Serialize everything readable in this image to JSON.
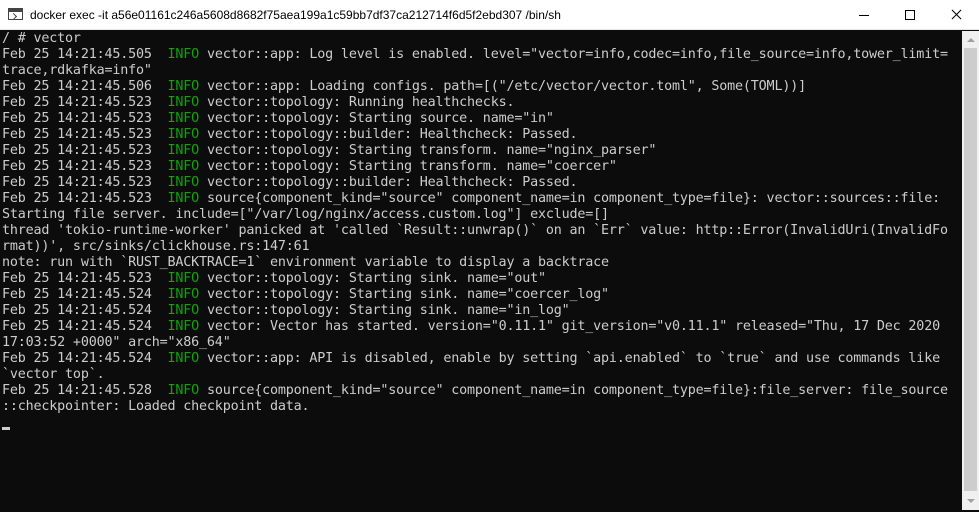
{
  "window": {
    "title": "docker  exec -it a56e01161c246a5608d8682f75aea199a1c59bb7df37ca212714f6d5f2ebd307 /bin/sh",
    "icon": "console-app-icon"
  },
  "controls": {
    "minimize_icon": "minimize-icon",
    "maximize_icon": "maximize-icon",
    "close_icon": "close-icon"
  },
  "colors": {
    "background": "#0c0c0c",
    "text": "#cccccc",
    "info": "#13a10e"
  },
  "console": {
    "lines": [
      {
        "text": "/ # vector"
      },
      {
        "pre": "Feb 25 14:21:45.505  ",
        "level": "INFO",
        "post": " vector::app: Log level is enabled. level=\"vector=info,codec=info,file_source=info,tower_limit="
      },
      {
        "text": "trace,rdkafka=info\""
      },
      {
        "pre": "Feb 25 14:21:45.506  ",
        "level": "INFO",
        "post": " vector::app: Loading configs. path=[(\"/etc/vector/vector.toml\", Some(TOML))]"
      },
      {
        "pre": "Feb 25 14:21:45.523  ",
        "level": "INFO",
        "post": " vector::topology: Running healthchecks."
      },
      {
        "pre": "Feb 25 14:21:45.523  ",
        "level": "INFO",
        "post": " vector::topology: Starting source. name=\"in\""
      },
      {
        "pre": "Feb 25 14:21:45.523  ",
        "level": "INFO",
        "post": " vector::topology::builder: Healthcheck: Passed."
      },
      {
        "pre": "Feb 25 14:21:45.523  ",
        "level": "INFO",
        "post": " vector::topology: Starting transform. name=\"nginx_parser\""
      },
      {
        "pre": "Feb 25 14:21:45.523  ",
        "level": "INFO",
        "post": " vector::topology: Starting transform. name=\"coercer\""
      },
      {
        "pre": "Feb 25 14:21:45.523  ",
        "level": "INFO",
        "post": " vector::topology::builder: Healthcheck: Passed."
      },
      {
        "pre": "Feb 25 14:21:45.523  ",
        "level": "INFO",
        "post": " source{component_kind=\"source\" component_name=in component_type=file}: vector::sources::file:"
      },
      {
        "text": "Starting file server. include=[\"/var/log/nginx/access.custom.log\"] exclude=[]"
      },
      {
        "text": "thread 'tokio-runtime-worker' panicked at 'called `Result::unwrap()` on an `Err` value: http::Error(InvalidUri(InvalidFo"
      },
      {
        "text": "rmat))', src/sinks/clickhouse.rs:147:61"
      },
      {
        "text": "note: run with `RUST_BACKTRACE=1` environment variable to display a backtrace"
      },
      {
        "pre": "Feb 25 14:21:45.523  ",
        "level": "INFO",
        "post": " vector::topology: Starting sink. name=\"out\""
      },
      {
        "pre": "Feb 25 14:21:45.524  ",
        "level": "INFO",
        "post": " vector::topology: Starting sink. name=\"coercer_log\""
      },
      {
        "pre": "Feb 25 14:21:45.524  ",
        "level": "INFO",
        "post": " vector::topology: Starting sink. name=\"in_log\""
      },
      {
        "pre": "Feb 25 14:21:45.524  ",
        "level": "INFO",
        "post": " vector: Vector has started. version=\"0.11.1\" git_version=\"v0.11.1\" released=\"Thu, 17 Dec 2020"
      },
      {
        "text": "17:03:52 +0000\" arch=\"x86_64\""
      },
      {
        "pre": "Feb 25 14:21:45.524  ",
        "level": "INFO",
        "post": " vector::app: API is disabled, enable by setting `api.enabled` to `true` and use commands like"
      },
      {
        "text": "`vector top`."
      },
      {
        "pre": "Feb 25 14:21:45.528  ",
        "level": "INFO",
        "post": " source{component_kind=\"source\" component_name=in component_type=file}:file_server: file_source"
      },
      {
        "text": "::checkpointer: Loaded checkpoint data."
      }
    ]
  }
}
